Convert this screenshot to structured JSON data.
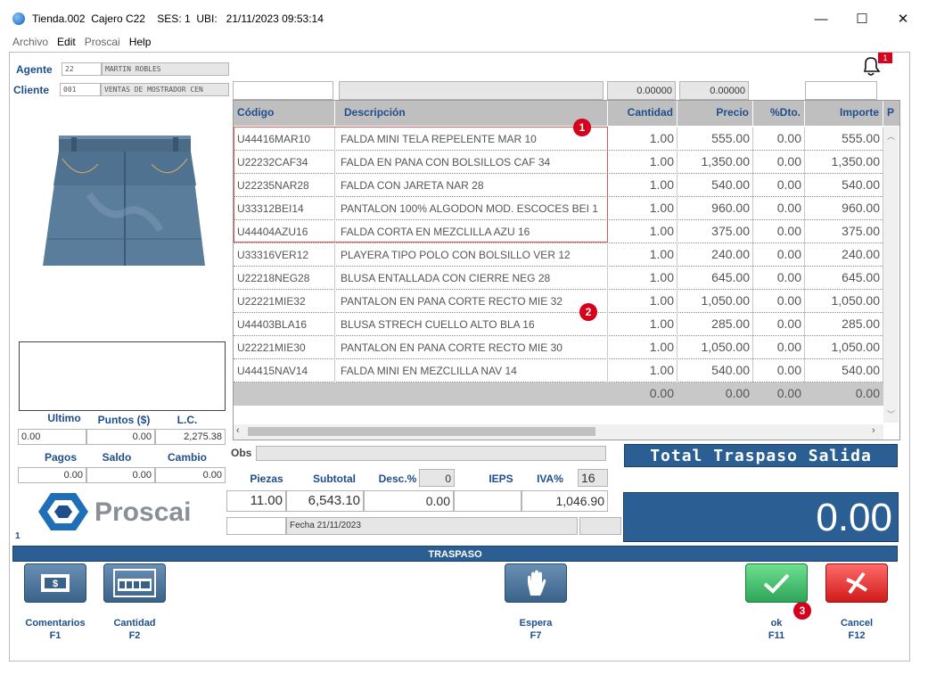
{
  "window": {
    "title": "Tienda.002  Cajero C22    SES: 1  UBI:   21/11/2023 09:53:14",
    "minimize": "—",
    "maximize": "☐",
    "close": "✕"
  },
  "menu": [
    "Archivo",
    "Edit",
    "Proscai",
    "Help"
  ],
  "notification_count": "1",
  "agent": {
    "label": "Agente",
    "code": "22",
    "name": "MARTIN ROBLES"
  },
  "client": {
    "label": "Cliente",
    "code": "001",
    "name": "VENTAS DE MOSTRADOR CEN"
  },
  "top_inputs": {
    "a": "",
    "b": "",
    "c": "0.00000",
    "d": "0.00000",
    "e": ""
  },
  "grid": {
    "headers": [
      "Código",
      "Descripción",
      "Cantidad",
      "Precio",
      "%Dto.",
      "Importe",
      "P"
    ],
    "rows": [
      [
        "U44416MAR10",
        "FALDA MINI TELA REPELENTE MAR 10",
        "1.00",
        "555.00",
        "0.00",
        "555.00"
      ],
      [
        "U22232CAF34",
        "FALDA EN PANA CON BOLSILLOS CAF 34",
        "1.00",
        "1,350.00",
        "0.00",
        "1,350.00"
      ],
      [
        "U22235NAR28",
        "FALDA CON JARETA NAR 28",
        "1.00",
        "540.00",
        "0.00",
        "540.00"
      ],
      [
        "U33312BEI14",
        "PANTALON 100%  ALGODON MOD. ESCOCES BEI 1",
        "1.00",
        "960.00",
        "0.00",
        "960.00"
      ],
      [
        "U44404AZU16",
        "FALDA CORTA EN MEZCLILLA AZU 16",
        "1.00",
        "375.00",
        "0.00",
        "375.00"
      ],
      [
        "U33316VER12",
        "PLAYERA TIPO POLO CON BOLSILLO VER 12",
        "1.00",
        "240.00",
        "0.00",
        "240.00"
      ],
      [
        "U22218NEG28",
        "BLUSA ENTALLADA CON CIERRE NEG 28",
        "1.00",
        "645.00",
        "0.00",
        "645.00"
      ],
      [
        "U22221MIE32",
        "PANTALON EN PANA CORTE RECTO MIE 32",
        "1.00",
        "1,050.00",
        "0.00",
        "1,050.00"
      ],
      [
        "U44403BLA16",
        "BLUSA STRECH CUELLO ALTO BLA 16",
        "1.00",
        "285.00",
        "0.00",
        "285.00"
      ],
      [
        "U22221MIE30",
        "PANTALON EN PANA CORTE RECTO MIE 30",
        "1.00",
        "1,050.00",
        "0.00",
        "1,050.00"
      ],
      [
        "U44415NAV14",
        "FALDA MINI EN MEZCLILLA NAV 14",
        "1.00",
        "540.00",
        "0.00",
        "540.00"
      ]
    ],
    "totals": [
      "",
      "",
      "0.00",
      "0.00",
      "0.00",
      "0.00"
    ]
  },
  "badges": [
    "1",
    "2",
    "3"
  ],
  "stats1": {
    "labels": [
      "Ultimo",
      "Puntos ($)",
      "L.C."
    ],
    "values": [
      "0.00",
      "0.00",
      "2,275.38"
    ]
  },
  "stats2": {
    "labels": [
      "Pagos",
      "Saldo",
      "Cambio"
    ],
    "values": [
      "0.00",
      "0.00",
      "0.00"
    ]
  },
  "brand": "Proscai",
  "page_number": "1",
  "obs_label": "Obs",
  "obs_value": "",
  "totals": {
    "labels": [
      "Piezas",
      "Subtotal",
      "Desc.%",
      "IEPS",
      "IVA%"
    ],
    "desc_pct": "0",
    "iva_pct": "16",
    "piezas": "11.00",
    "subtotal": "6,543.10",
    "desc": "0.00",
    "ieps": "",
    "iva": "1,046.90"
  },
  "fecha": "Fecha 21/11/2023",
  "banner": "Total Traspaso Salida",
  "big_total": "0.00",
  "status": "TRASPASO",
  "buttons": [
    {
      "label": "Comentarios",
      "key": "F1"
    },
    {
      "label": "Cantidad",
      "key": "F2"
    },
    {
      "label": "Espera",
      "key": "F7"
    },
    {
      "label": "ok",
      "key": "F11"
    },
    {
      "label": "Cancel",
      "key": "F12"
    }
  ],
  "icons": {
    "comentarios": "money-icon",
    "cantidad": "keypad-icon",
    "espera": "hand-icon",
    "ok": "check-icon",
    "cancel": "x-icon"
  },
  "colors": {
    "accent": "#2b5f93",
    "label": "#1f4e8c",
    "ok": "#2ea55a",
    "cancel": "#d11a1a",
    "badge": "#d6001c"
  }
}
